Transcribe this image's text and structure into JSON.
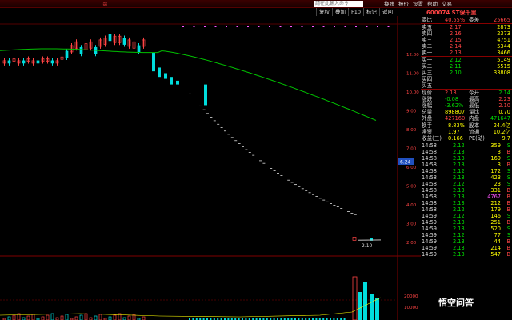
{
  "app": {
    "logo": "≋"
  },
  "search": {
    "placeholder": "請在此輸入命令"
  },
  "top_menu": [
    "换肤",
    "报价",
    "设置",
    "帮助",
    "交易"
  ],
  "toolbar": [
    "复权",
    "叠加",
    "F10",
    "标记",
    "返回"
  ],
  "stock": {
    "code_name": "600074 ST保千里"
  },
  "colors": {
    "up": "#ff4444",
    "down": "#00e000",
    "ma": "#00c000",
    "axis": "#800000",
    "price_axis": "#ff4444",
    "vol_axis": "#ff4444"
  },
  "price_axis": {
    "labels": [
      "12.00",
      "11.00",
      "10.00",
      "9.00",
      "8.00",
      "7.00",
      "6.00",
      "5.00",
      "4.00",
      "3.00",
      "2.00"
    ],
    "current_tag": "6.24"
  },
  "vol_axis": {
    "labels": [
      "20000",
      "10000"
    ]
  },
  "chart_data": {
    "type": "candlestick",
    "last_label": "2.10",
    "ma_start": 12.2,
    "ma_end": 8.4
  },
  "panel": {
    "ratio": {
      "l1": "委比",
      "v1": "40.55%",
      "l2": "委差",
      "v2": "25665"
    },
    "sells": [
      {
        "l": "卖五",
        "p": "2.17",
        "v": "2873"
      },
      {
        "l": "卖四",
        "p": "2.16",
        "v": "2373"
      },
      {
        "l": "卖三",
        "p": "2.15",
        "v": "4751"
      },
      {
        "l": "卖二",
        "p": "2.14",
        "v": "5344"
      },
      {
        "l": "卖一",
        "p": "2.13",
        "v": "3466"
      }
    ],
    "buys": [
      {
        "l": "买一",
        "p": "2.12",
        "v": "5149"
      },
      {
        "l": "买二",
        "p": "2.11",
        "v": "5515"
      },
      {
        "l": "买三",
        "p": "2.10",
        "v": "33808"
      },
      {
        "l": "买四",
        "p": "",
        "v": ""
      },
      {
        "l": "买五",
        "p": "",
        "v": ""
      }
    ],
    "quote": [
      {
        "l1": "现价",
        "v1": "2.13",
        "l2": "今开",
        "v2": "2.14"
      },
      {
        "l1": "涨跌",
        "v1": "-0.08",
        "l2": "最高",
        "v2": "2.23"
      },
      {
        "l1": "涨幅",
        "v1": "-3.62%",
        "l2": "最低",
        "v2": "2.10"
      },
      {
        "l1": "总量",
        "v1": "898807",
        "l2": "量比",
        "v2": "0.70"
      },
      {
        "l1": "外盘",
        "v1": "427160",
        "l2": "内盘",
        "v2": "471647"
      }
    ],
    "stats": [
      {
        "l1": "换手",
        "v1": "8.83%",
        "l2": "股本",
        "v2": "24.4亿"
      },
      {
        "l1": "净资",
        "v1": "1.97",
        "l2": "流通",
        "v2": "10.2亿"
      },
      {
        "l1": "收益(三)",
        "v1": "0.166",
        "l2": "PE(动)",
        "v2": "9.7"
      }
    ],
    "ticks": [
      {
        "t": "14:58",
        "p": "2.12",
        "v": "359",
        "f": "S"
      },
      {
        "t": "14:58",
        "p": "2.13",
        "v": "3",
        "f": "B"
      },
      {
        "t": "14:58",
        "p": "2.13",
        "v": "169",
        "f": "S"
      },
      {
        "t": "14:58",
        "p": "2.13",
        "v": "3",
        "f": "B"
      },
      {
        "t": "14:58",
        "p": "2.12",
        "v": "172",
        "f": "S"
      },
      {
        "t": "14:58",
        "p": "2.13",
        "v": "423",
        "f": "S"
      },
      {
        "t": "14:58",
        "p": "2.12",
        "v": "23",
        "f": "S"
      },
      {
        "t": "14:58",
        "p": "2.13",
        "v": "331",
        "f": "B"
      },
      {
        "t": "14:58",
        "p": "2.13",
        "v": "4767",
        "f": "B"
      },
      {
        "t": "14:58",
        "p": "2.13",
        "v": "212",
        "f": "B"
      },
      {
        "t": "14:58",
        "p": "2.12",
        "v": "179",
        "f": "B"
      },
      {
        "t": "14:59",
        "p": "2.12",
        "v": "146",
        "f": "S"
      },
      {
        "t": "14:59",
        "p": "2.13",
        "v": "251",
        "f": "B"
      },
      {
        "t": "14:59",
        "p": "2.13",
        "v": "520",
        "f": "S"
      },
      {
        "t": "14:59",
        "p": "2.12",
        "v": "77",
        "f": "S"
      },
      {
        "t": "14:59",
        "p": "2.13",
        "v": "44",
        "f": "B"
      },
      {
        "t": "14:59",
        "p": "2.13",
        "v": "214",
        "f": "B"
      },
      {
        "t": "14:59",
        "p": "2.13",
        "v": "547",
        "f": "B"
      }
    ]
  },
  "watermark": "悟空问答"
}
